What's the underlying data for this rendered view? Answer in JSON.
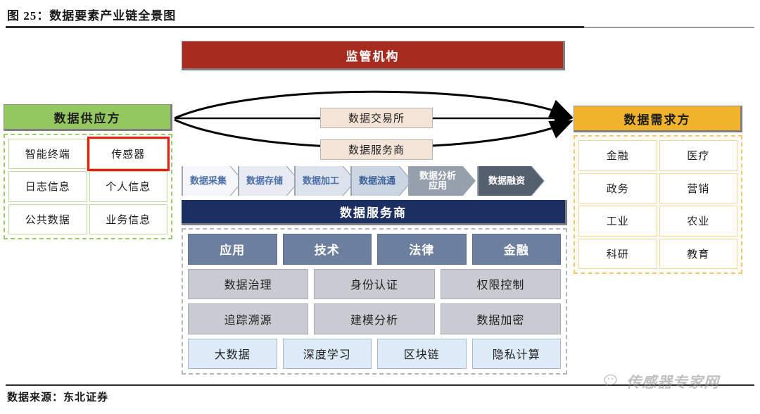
{
  "figure": {
    "title": "图 25：数据要素产业链全景图",
    "source": "数据来源：东北证券",
    "watermark": "传感器专家网"
  },
  "regulator": {
    "label": "监管机构",
    "color": "#a82b20"
  },
  "intermediaries": [
    {
      "label": "数据交易所"
    },
    {
      "label": "数据服务商"
    }
  ],
  "supplier": {
    "header": "数据供应方",
    "color": "#93c860",
    "items": [
      {
        "label": "智能终端",
        "highlight": false
      },
      {
        "label": "传感器",
        "highlight": true
      },
      {
        "label": "日志信息",
        "highlight": false
      },
      {
        "label": "个人信息",
        "highlight": false
      },
      {
        "label": "公共数据",
        "highlight": false
      },
      {
        "label": "业务信息",
        "highlight": false
      }
    ]
  },
  "demander": {
    "header": "数据需求方",
    "color": "#f0b32b",
    "items": [
      {
        "label": "金融"
      },
      {
        "label": "医疗"
      },
      {
        "label": "政务"
      },
      {
        "label": "营销"
      },
      {
        "label": "工业"
      },
      {
        "label": "农业"
      },
      {
        "label": "科研"
      },
      {
        "label": "教育"
      }
    ]
  },
  "process_chain": [
    {
      "label": "数据采集",
      "fill": "#f4f6f9",
      "text": "#4b6fa8"
    },
    {
      "label": "数据存储",
      "fill": "#e8ecf2",
      "text": "#4b6fa8"
    },
    {
      "label": "数据加工",
      "fill": "#dde3ec",
      "text": "#4b6fa8"
    },
    {
      "label": "数据流通",
      "fill": "#ccd6e3",
      "text": "#3a5f96"
    },
    {
      "label": "数据分析\n应用",
      "fill": "#96a0ad",
      "text": "#ffffff"
    },
    {
      "label": "数据融资",
      "fill": "#55606f",
      "text": "#ffffff"
    }
  ],
  "service_provider": {
    "header": "数据服务商",
    "color": "#1c2f62",
    "rows": [
      {
        "style": "blue",
        "cells": [
          "应用",
          "技术",
          "法律",
          "金融"
        ]
      },
      {
        "style": "gray",
        "cells": [
          "数据治理",
          "身份认证",
          "权限控制"
        ]
      },
      {
        "style": "gray",
        "cells": [
          "追踪溯源",
          "建模分析",
          "数据加密"
        ]
      },
      {
        "style": "light",
        "cells": [
          "大数据",
          "深度学习",
          "区块链",
          "隐私计算"
        ]
      }
    ]
  }
}
